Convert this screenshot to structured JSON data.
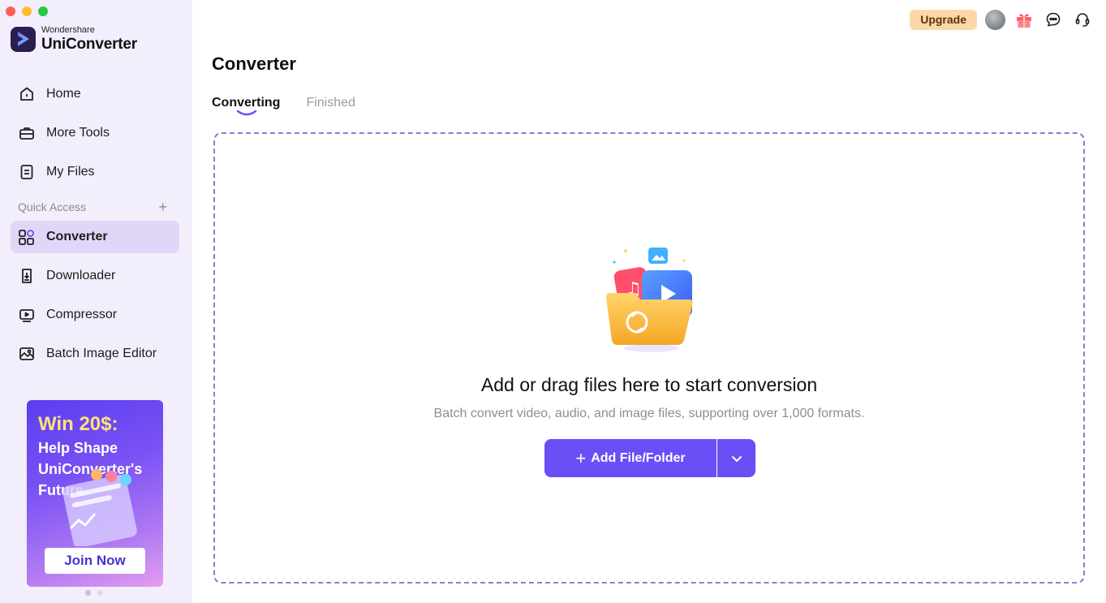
{
  "brand": {
    "company": "Wondershare",
    "product": "UniConverter"
  },
  "nav": {
    "top": [
      {
        "label": "Home",
        "icon": "home-icon"
      },
      {
        "label": "More Tools",
        "icon": "toolbox-icon"
      },
      {
        "label": "My Files",
        "icon": "file-icon"
      }
    ],
    "quick_access_label": "Quick Access",
    "quick": [
      {
        "label": "Converter",
        "icon": "converter-icon",
        "active": true
      },
      {
        "label": "Downloader",
        "icon": "downloader-icon"
      },
      {
        "label": "Compressor",
        "icon": "compressor-icon"
      },
      {
        "label": "Batch Image Editor",
        "icon": "image-editor-icon"
      }
    ]
  },
  "promo": {
    "title": "Win 20$:",
    "subtitle": "Help Shape UniConverter's Future",
    "button": "Join Now"
  },
  "topbar": {
    "upgrade": "Upgrade"
  },
  "main": {
    "title": "Converter",
    "tabs": [
      {
        "label": "Converting",
        "active": true
      },
      {
        "label": "Finished",
        "active": false
      }
    ],
    "dropzone": {
      "title": "Add or drag files here to start conversion",
      "subtitle": "Batch convert video, audio, and image files, supporting over 1,000 formats.",
      "button": "Add File/Folder"
    }
  },
  "colors": {
    "accent": "#6b4ef6",
    "sidebar_bg": "#f3eefb",
    "active_item": "#e2d6f8",
    "upgrade_bg": "#fcd8a8"
  }
}
